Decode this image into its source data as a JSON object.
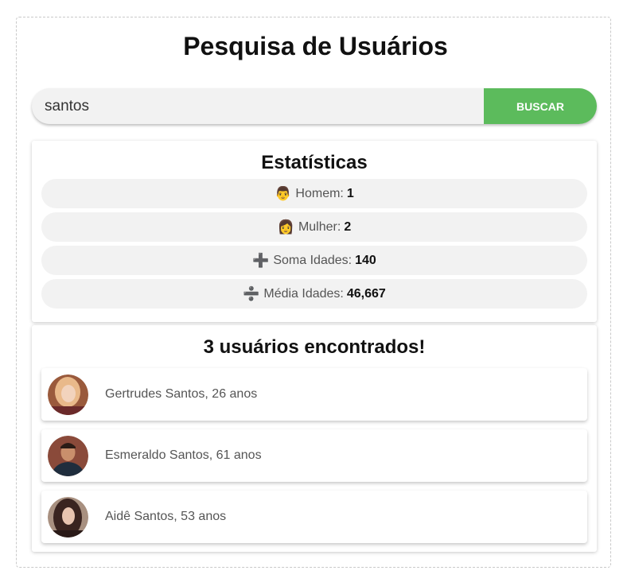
{
  "page": {
    "title": "Pesquisa de Usuários"
  },
  "search": {
    "value": "santos",
    "button_label": "BUSCAR"
  },
  "stats": {
    "title": "Estatísticas",
    "items": [
      {
        "icon": "man-emoji",
        "label": "Homem:",
        "value": "1"
      },
      {
        "icon": "woman-emoji",
        "label": "Mulher:",
        "value": "2"
      },
      {
        "icon": "plus-icon",
        "label": "Soma Idades:",
        "value": "140"
      },
      {
        "icon": "divide-icon",
        "label": "Média Idades:",
        "value": "46,667"
      }
    ]
  },
  "results": {
    "title": "3 usuários encontrados!",
    "users": [
      {
        "name": "Gertrudes Santos, 26 anos",
        "avatar_color": "#8b4a2e"
      },
      {
        "name": "Esmeraldo Santos, 61 anos",
        "avatar_color": "#2d3a4a"
      },
      {
        "name": "Aidê Santos, 53 anos",
        "avatar_color": "#5a3a3a"
      }
    ]
  },
  "colors": {
    "accent": "#5cbb5c",
    "pill_bg": "#f2f2f2"
  }
}
